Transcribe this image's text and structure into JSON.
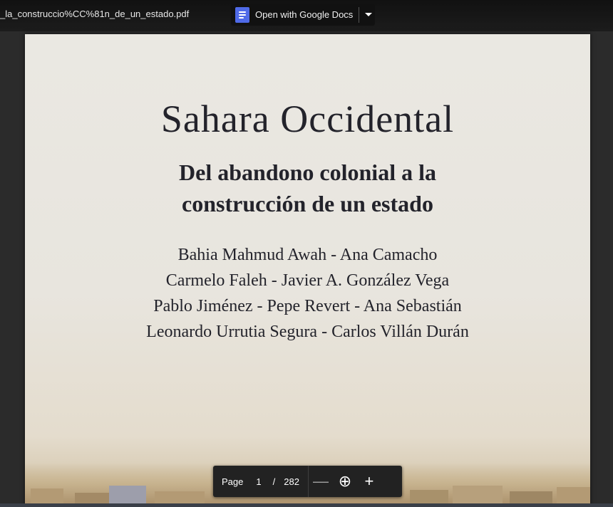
{
  "toolbar": {
    "file_name": "_la_construccio%CC%81n_de_un_estado.pdf",
    "open_with_label": "Open with Google Docs",
    "docs_icon": "google-docs-icon",
    "dropdown_icon": "caret-down-icon"
  },
  "document": {
    "title": "Sahara Occidental",
    "subtitle_lines": [
      "Del abandono colonial a la",
      "construcción de un estado"
    ],
    "authors": [
      "Bahia Mahmud Awah - Ana Camacho",
      "Carmelo Faleh - Javier A. González Vega",
      "Pablo Jiménez - Pepe Revert - Ana Sebastián",
      "Leonardo Urrutia Segura - Carlos Villán Durán"
    ]
  },
  "pager": {
    "page_label": "Page",
    "current_page": "1",
    "separator": "/",
    "total_pages": "282",
    "zoom_out_symbol": "—",
    "zoom_icon_symbol": "⊕",
    "zoom_in_symbol": "+"
  },
  "colors": {
    "accent_docs": "#4f6ae8",
    "toolbar_bg": "#1c1c1c",
    "page_title_text": "#23232b"
  }
}
